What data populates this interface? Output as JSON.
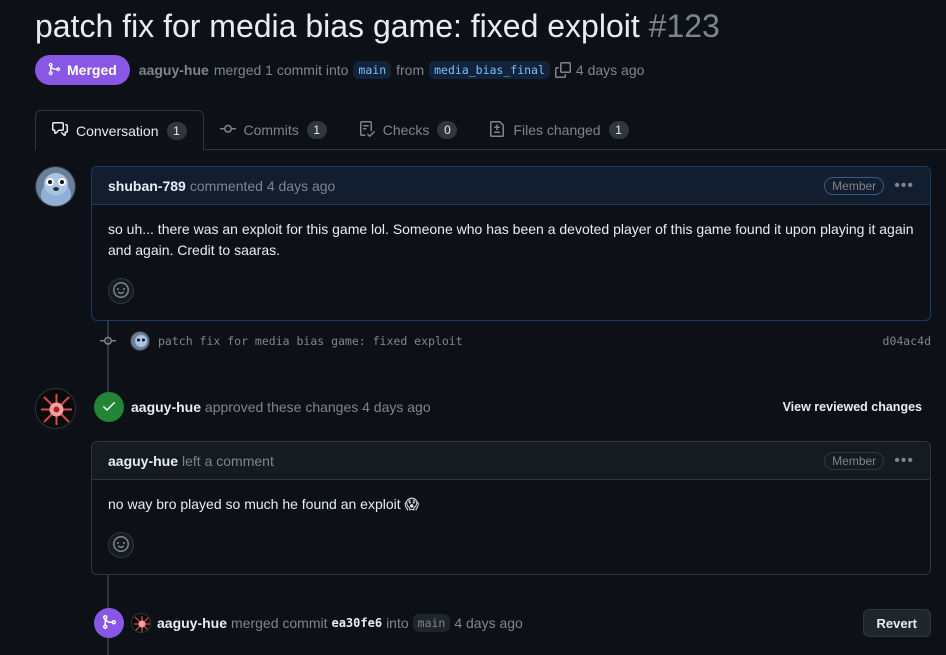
{
  "pr": {
    "title": "patch fix for media bias game: fixed exploit",
    "number": "#123",
    "state": "Merged",
    "author": "aaguy-hue",
    "merged_text": "merged 1 commit into",
    "base_branch": "main",
    "from_text": "from",
    "head_branch": "media_bias_final",
    "time": "4 days ago"
  },
  "tabs": [
    {
      "label": "Conversation",
      "count": "1",
      "icon": "comment-discussion-icon"
    },
    {
      "label": "Commits",
      "count": "1",
      "icon": "git-commit-icon"
    },
    {
      "label": "Checks",
      "count": "0",
      "icon": "checklist-icon"
    },
    {
      "label": "Files changed",
      "count": "1",
      "icon": "file-diff-icon"
    }
  ],
  "comment1": {
    "author": "shuban-789",
    "action": "commented 4 days ago",
    "role": "Member",
    "body": "so uh... there was an exploit for this game lol. Someone who has been a devoted player of this game found it upon playing it again and again. Credit to saaras."
  },
  "commit": {
    "message": "patch fix for media bias game: fixed exploit",
    "sha": "d04ac4d"
  },
  "review": {
    "author": "aaguy-hue",
    "action": "approved these changes 4 days ago",
    "view_label": "View reviewed changes",
    "comment_author": "aaguy-hue",
    "comment_action": "left a comment",
    "role": "Member",
    "body": "no way bro played so much he found an exploit 😱"
  },
  "merge": {
    "author": "aaguy-hue",
    "action": "merged commit",
    "sha": "ea30fe6",
    "into": "into",
    "branch": "main",
    "time": "4 days ago",
    "revert_label": "Revert"
  },
  "colors": {
    "merged": "#8957e5",
    "approved": "#238636",
    "background": "#0d1117",
    "border": "#30363d"
  }
}
